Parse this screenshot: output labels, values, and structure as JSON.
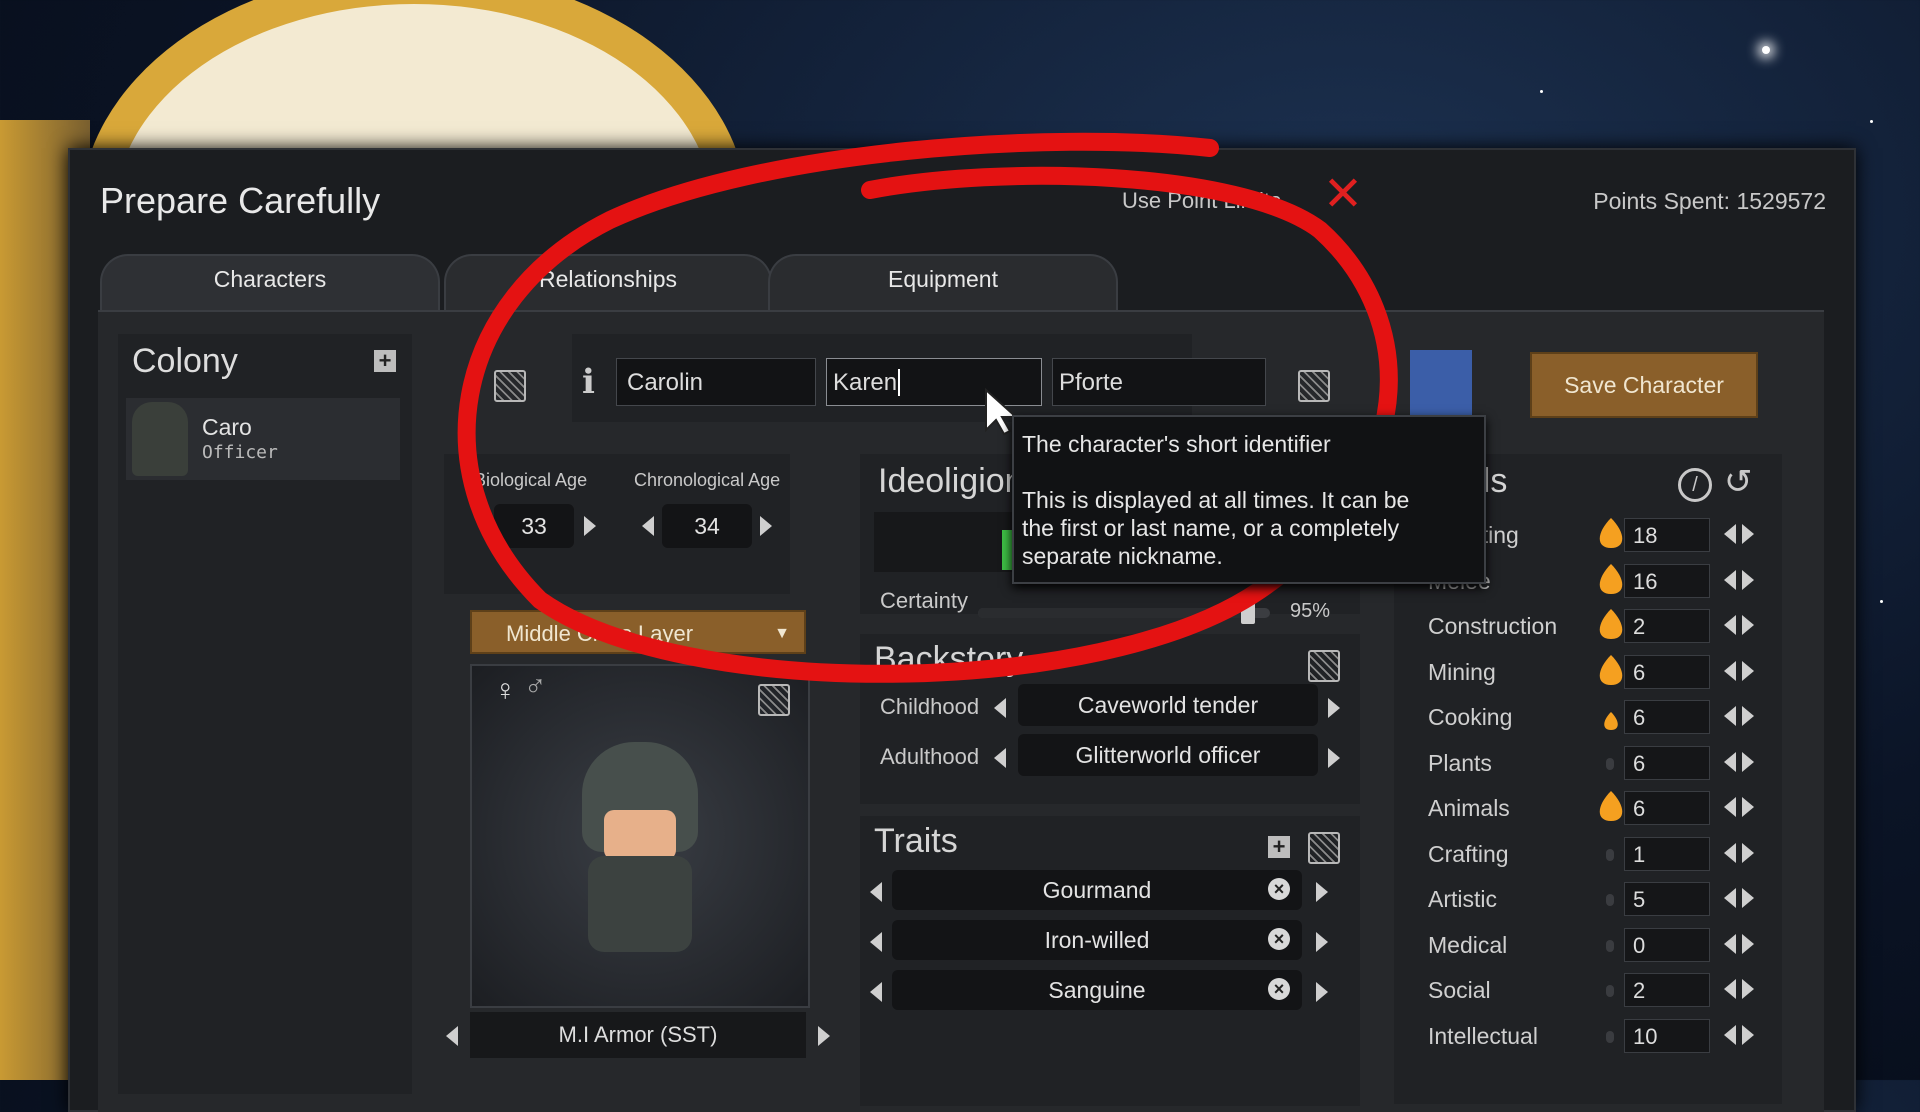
{
  "window": {
    "title": "Prepare Carefully",
    "limits_label": "Use Point Limits",
    "points_spent": "Points Spent: 1529572"
  },
  "tabs": [
    {
      "label": "Characters"
    },
    {
      "label": "Relationships"
    },
    {
      "label": "Equipment"
    }
  ],
  "colony": {
    "header": "Colony",
    "pawn_name": "Caro",
    "pawn_title": "Officer"
  },
  "name_fields": {
    "first": "Carolin",
    "nick": "Karen",
    "last": "Pforte"
  },
  "save_button": "Save Character",
  "ages": {
    "bio_label": "Biological Age",
    "bio_value": "33",
    "chrono_label": "Chronological Age",
    "chrono_value": "34"
  },
  "faction_dropdown": "Middle Class Layer",
  "ideology": {
    "header": "Ideoligion",
    "certainty_label": "Certainty",
    "certainty_value": "95%",
    "certainty_fraction": 0.95
  },
  "tooltip": {
    "title": "The character's short identifier",
    "line1": "This is displayed at all times. It can be",
    "line2": "the first or last name, or a completely",
    "line3": "separate nickname."
  },
  "backstory": {
    "header": "Backstory",
    "childhood_label": "Childhood",
    "childhood_value": "Caveworld tender",
    "adulthood_label": "Adulthood",
    "adulthood_value": "Glitterworld officer"
  },
  "traits": {
    "header": "Traits",
    "items": [
      "Gourmand",
      "Iron-willed",
      "Sanguine"
    ]
  },
  "apparel": {
    "label": "M.I Armor (SST)"
  },
  "gender_symbols": {
    "female": "♀",
    "male": "♂"
  },
  "skills": {
    "header": "Skills",
    "items": [
      {
        "name": "Shooting",
        "value": "18",
        "passion": "major"
      },
      {
        "name": "Melee",
        "value": "16",
        "passion": "major"
      },
      {
        "name": "Construction",
        "value": "2",
        "passion": "major"
      },
      {
        "name": "Mining",
        "value": "6",
        "passion": "major"
      },
      {
        "name": "Cooking",
        "value": "6",
        "passion": "minor"
      },
      {
        "name": "Plants",
        "value": "6",
        "passion": "none"
      },
      {
        "name": "Animals",
        "value": "6",
        "passion": "major"
      },
      {
        "name": "Crafting",
        "value": "1",
        "passion": "none"
      },
      {
        "name": "Artistic",
        "value": "5",
        "passion": "none"
      },
      {
        "name": "Medical",
        "value": "0",
        "passion": "none"
      },
      {
        "name": "Social",
        "value": "2",
        "passion": "none"
      },
      {
        "name": "Intellectual",
        "value": "10",
        "passion": "none"
      }
    ]
  },
  "colors": {
    "annotation": "#e41212",
    "save_button": "#8a5f2a",
    "flame": "#f5a020",
    "close_red": "#e02020"
  },
  "icons": [
    "plus-icon",
    "dice-icon",
    "info-icon",
    "close-icon",
    "no-entry-icon",
    "reset-icon",
    "flame-icon",
    "remove-icon"
  ]
}
